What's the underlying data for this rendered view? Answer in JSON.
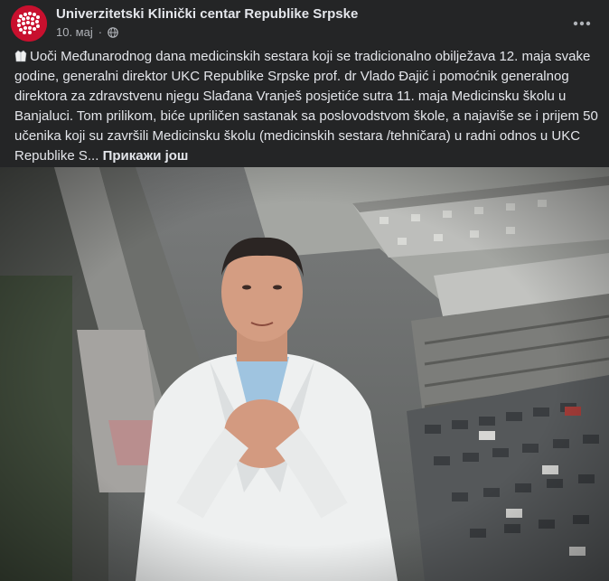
{
  "page": {
    "name": "Univerzitetski Klinički centar Republike Srpske",
    "date": "10. мај",
    "privacy_icon": "globe-icon",
    "avatar_icon": "ukc-logo",
    "more_icon": "more-horizontal-icon"
  },
  "post": {
    "text_icon": "lab-coat-icon",
    "text": "Uoči Međunarodnog dana medicinskih sestara koji se tradicionalno obilježava 12. maja svake godine, generalni direktor UKC Republike Srpske prof. dr Vlado Đajić i pomoćnik generalnog direktora za zdravstvenu njegu Slađana Vranješ posjetiće sutra 11. maja Medicinsku školu u Banjaluci. Tom prilikom, biće upriličen sastanak sa poslovodstvom škole, a najaviše se i prijem 50 učenika koji su završili Medicinsku školu (medicinskih sestara /tehničara) u radni odnos u UKC Republike S...",
    "see_more": "Прикажи још"
  },
  "colors": {
    "background": "#242526",
    "text_primary": "#e4e6eb",
    "text_secondary": "#b0b3b8",
    "brand_red": "#c8102e"
  }
}
